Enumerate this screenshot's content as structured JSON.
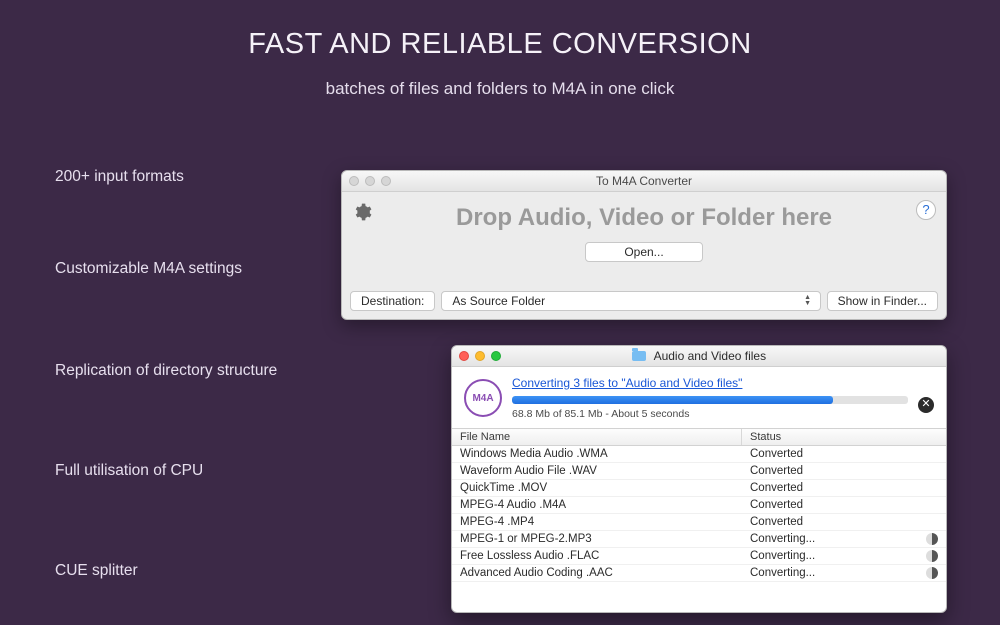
{
  "heading": "FAST AND RELIABLE CONVERSION",
  "subheading": "batches of files and folders to M4A in one click",
  "features": [
    "200+ input formats",
    "Customizable M4A settings",
    "Replication of directory structure",
    "Full utilisation of CPU",
    "CUE splitter"
  ],
  "converter_window": {
    "title": "To M4A Converter",
    "gear_icon": "gear-icon",
    "help_symbol": "?",
    "drop_message": "Drop Audio, Video or Folder here",
    "open_label": "Open...",
    "destination_label": "Destination:",
    "destination_value": "As Source Folder",
    "show_in_finder_label": "Show in Finder..."
  },
  "progress_window": {
    "folder_title": "Audio and Video files",
    "badge_text": "M4A",
    "link_text": "Converting 3 files to \"Audio and Video files\"",
    "progress_percent": 81,
    "status_text": "68.8 Mb of 85.1 Mb - About 5 seconds",
    "cancel_symbol": "✕",
    "columns": {
      "file_name": "File Name",
      "status": "Status"
    },
    "rows": [
      {
        "name": "Windows Media Audio .WMA",
        "status": "Converted",
        "spinning": false
      },
      {
        "name": "Waveform Audio File .WAV",
        "status": "Converted",
        "spinning": false
      },
      {
        "name": "QuickTime .MOV",
        "status": "Converted",
        "spinning": false
      },
      {
        "name": "MPEG-4 Audio .M4A",
        "status": "Converted",
        "spinning": false
      },
      {
        "name": "MPEG-4 .MP4",
        "status": "Converted",
        "spinning": false
      },
      {
        "name": "MPEG-1 or MPEG-2.MP3",
        "status": "Converting...",
        "spinning": true
      },
      {
        "name": "Free Lossless Audio .FLAC",
        "status": "Converting...",
        "spinning": true
      },
      {
        "name": "Advanced Audio Coding .AAC",
        "status": "Converting...",
        "spinning": true
      }
    ]
  }
}
